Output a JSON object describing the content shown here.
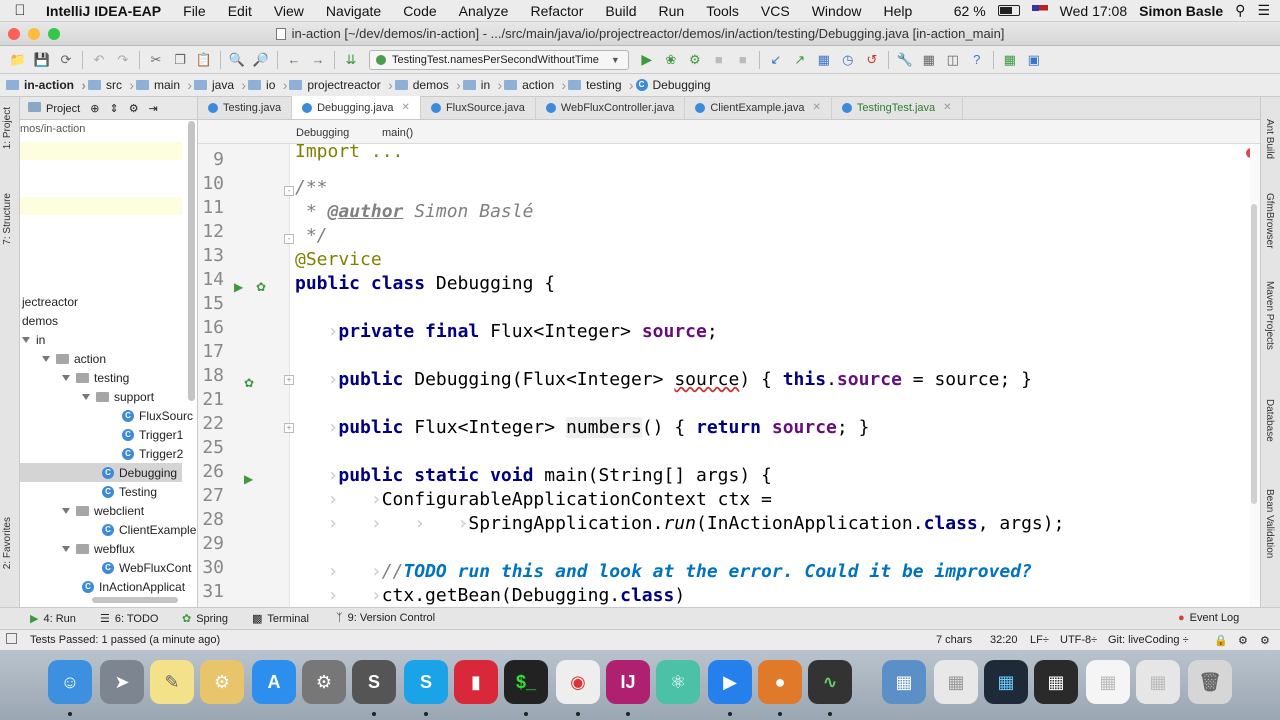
{
  "menubar": {
    "app": "IntelliJ IDEA-EAP",
    "items": [
      "File",
      "Edit",
      "View",
      "Navigate",
      "Code",
      "Analyze",
      "Refactor",
      "Build",
      "Run",
      "Tools",
      "VCS",
      "Window",
      "Help"
    ],
    "battery": "62 %",
    "clock": "Wed 17:08",
    "user": "Simon Basle"
  },
  "window": {
    "title": "in-action [~/dev/demos/in-action] - .../src/main/java/io/projectreactor/demos/in/action/testing/Debugging.java [in-action_main]"
  },
  "toolbar": {
    "run_config": "TestingTest.namesPerSecondWithoutTime"
  },
  "navbar": {
    "crumbs": [
      "in-action",
      "src",
      "main",
      "java",
      "io",
      "projectreactor",
      "demos",
      "in",
      "action",
      "testing",
      "Debugging"
    ]
  },
  "left_strip": {
    "project": "1: Project",
    "structure": "7: Structure",
    "favorites": "2: Favorites"
  },
  "project_panel": {
    "header": "Project",
    "path": "mos/in-action",
    "tree": [
      {
        "label": "jectreactor",
        "type": "pkg",
        "indent": 0,
        "expanded": false
      },
      {
        "label": "demos",
        "type": "pkg",
        "indent": 0,
        "expanded": false
      },
      {
        "label": "in",
        "type": "pkg",
        "indent": 0,
        "expanded": true
      },
      {
        "label": "action",
        "type": "pkg",
        "indent": 1,
        "expanded": true
      },
      {
        "label": "testing",
        "type": "pkg",
        "indent": 2,
        "expanded": true
      },
      {
        "label": "support",
        "type": "pkg",
        "indent": 3,
        "expanded": true
      },
      {
        "label": "FluxSourc",
        "type": "class",
        "indent": 4
      },
      {
        "label": "Trigger1",
        "type": "class",
        "indent": 4
      },
      {
        "label": "Trigger2",
        "type": "class",
        "indent": 4
      },
      {
        "label": "Debugging",
        "type": "class",
        "indent": 3,
        "selected": true
      },
      {
        "label": "Testing",
        "type": "class",
        "indent": 3
      },
      {
        "label": "webclient",
        "type": "pkg",
        "indent": 2,
        "expanded": true
      },
      {
        "label": "ClientExample",
        "type": "class",
        "indent": 3
      },
      {
        "label": "webflux",
        "type": "pkg",
        "indent": 2,
        "expanded": true
      },
      {
        "label": "WebFluxCont",
        "type": "class",
        "indent": 3
      },
      {
        "label": "InActionApplicat",
        "type": "class",
        "indent": 2
      }
    ]
  },
  "editor_tabs": [
    {
      "label": "Testing.java",
      "active": false,
      "test": false
    },
    {
      "label": "Debugging.java",
      "active": true,
      "test": false
    },
    {
      "label": "FluxSource.java",
      "active": false,
      "test": false
    },
    {
      "label": "WebFluxController.java",
      "active": false,
      "test": false
    },
    {
      "label": "ClientExample.java",
      "active": false,
      "test": false
    },
    {
      "label": "TestingTest.java",
      "active": false,
      "test": true
    }
  ],
  "editor_crumbs": {
    "class": "Debugging",
    "method": "main()"
  },
  "code": {
    "line_numbers": [
      "9",
      "10",
      "11",
      "12",
      "13",
      "14",
      "15",
      "16",
      "17",
      "18",
      "21",
      "22",
      "25",
      "26",
      "27",
      "28",
      "29",
      "30",
      "31"
    ],
    "l10": "/**",
    "l11_star": " * ",
    "l11_tag": "@author",
    "l11_text": " Simon Baslé",
    "l12": " */",
    "l13": "@Service",
    "l14_kw": "public class",
    "l14_rest": " Debugging {",
    "l16_kw": "private final",
    "l16_type": " Flux<Integer> ",
    "l16_field": "source",
    "l16_end": ";",
    "l18_kw": "public",
    "l18_a": " Debugging(Flux<Integer> ",
    "l18_param": "source",
    "l18_b": ") { ",
    "l18_this": "this",
    "l18_dot": ".",
    "l18_field": "source",
    "l18_c": " = source; }",
    "l22_kw": "public",
    "l22_a": " Flux<Integer> ",
    "l22_m": "numbers",
    "l22_b": "() { ",
    "l22_ret": "return",
    "l22_c": " ",
    "l22_field": "source",
    "l22_d": "; }",
    "l26_kw": "public static void",
    "l26_rest": " main(String[] args) {",
    "l27": "ConfigurableApplicationContext ctx =",
    "l28_a": "SpringApplication.",
    "l28_run": "run",
    "l28_b": "(InActionApplication.",
    "l28_cls": "class",
    "l28_c": ", args);",
    "l30_cmt": "//",
    "l30_todo": "TODO run this and look at the error. Could it be improved?",
    "l31_a": "ctx.getBean(Debugging.",
    "l31_cls": "class",
    "l31_b": ")"
  },
  "right_strip": {
    "ant": "Ant Build",
    "gfm": "GfmBrowser",
    "maven": "Maven Projects",
    "database": "Database",
    "bean": "Bean Validation"
  },
  "tool_tabs": {
    "run": "4: Run",
    "todo": "6: TODO",
    "spring": "Spring",
    "terminal": "Terminal",
    "vcs": "9: Version Control",
    "event_log": "Event Log"
  },
  "status": {
    "message": "Tests Passed: 1 passed (a minute ago)",
    "chars": "7 chars",
    "position": "32:20",
    "line_sep": "LF÷",
    "encoding": "UTF-8÷",
    "git": "Git: liveCoding ÷"
  }
}
